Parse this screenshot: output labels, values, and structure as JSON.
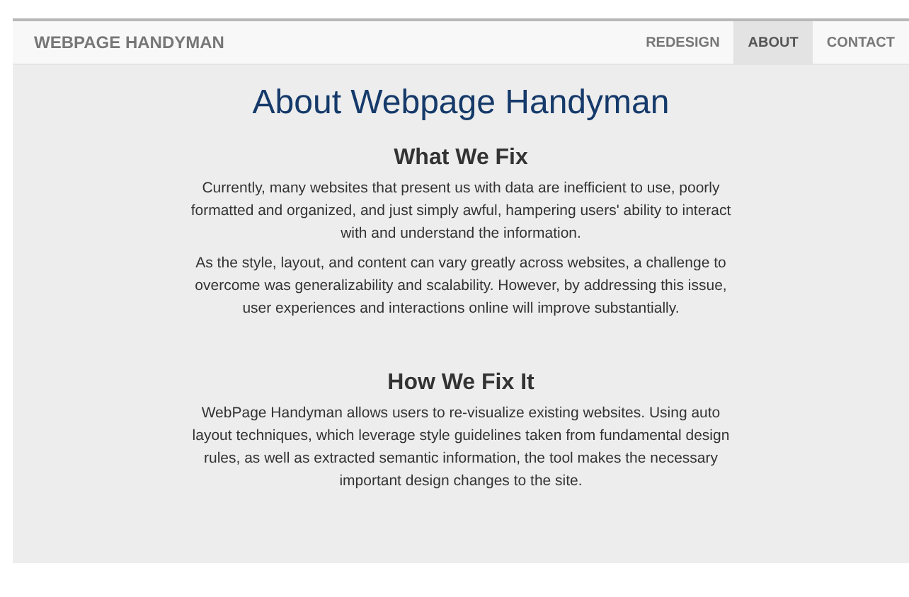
{
  "navbar": {
    "brand": "WEBPAGE HANDYMAN",
    "links": [
      {
        "label": "REDESIGN",
        "selected": false
      },
      {
        "label": "ABOUT",
        "selected": true
      },
      {
        "label": "CONTACT",
        "selected": false
      }
    ]
  },
  "title": "About Webpage Handyman",
  "sections": [
    {
      "heading": "What We Fix",
      "paragraphs": [
        "Currently, many websites that present us with data are inefficient to use, poorly formatted and organized, and just simply awful, hampering users' ability to interact with and understand the information.",
        "As the style, layout, and content can vary greatly across websites, a challenge to overcome was generalizability and scalability. However, by addressing this issue, user experiences and interactions online will improve substantially."
      ]
    },
    {
      "heading": "How We Fix It",
      "paragraphs": [
        "WebPage Handyman allows users to re-visualize existing websites. Using auto layout techniques, which leverage style guidelines taken from fundamental design rules, as well as extracted semantic information, the tool makes the necessary important design changes to the site."
      ]
    }
  ]
}
